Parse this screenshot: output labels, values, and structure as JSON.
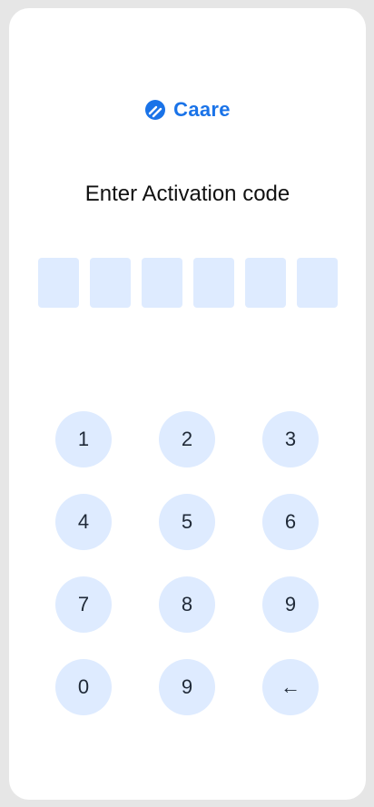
{
  "brand": {
    "name": "Caare",
    "color": "#1a73e8"
  },
  "title": "Enter Activation code",
  "code_boxes": [
    "",
    "",
    "",
    "",
    "",
    ""
  ],
  "keypad": {
    "keys": [
      "1",
      "2",
      "3",
      "4",
      "5",
      "6",
      "7",
      "8",
      "9",
      "0",
      "9",
      "←"
    ],
    "background": "#deebff"
  }
}
